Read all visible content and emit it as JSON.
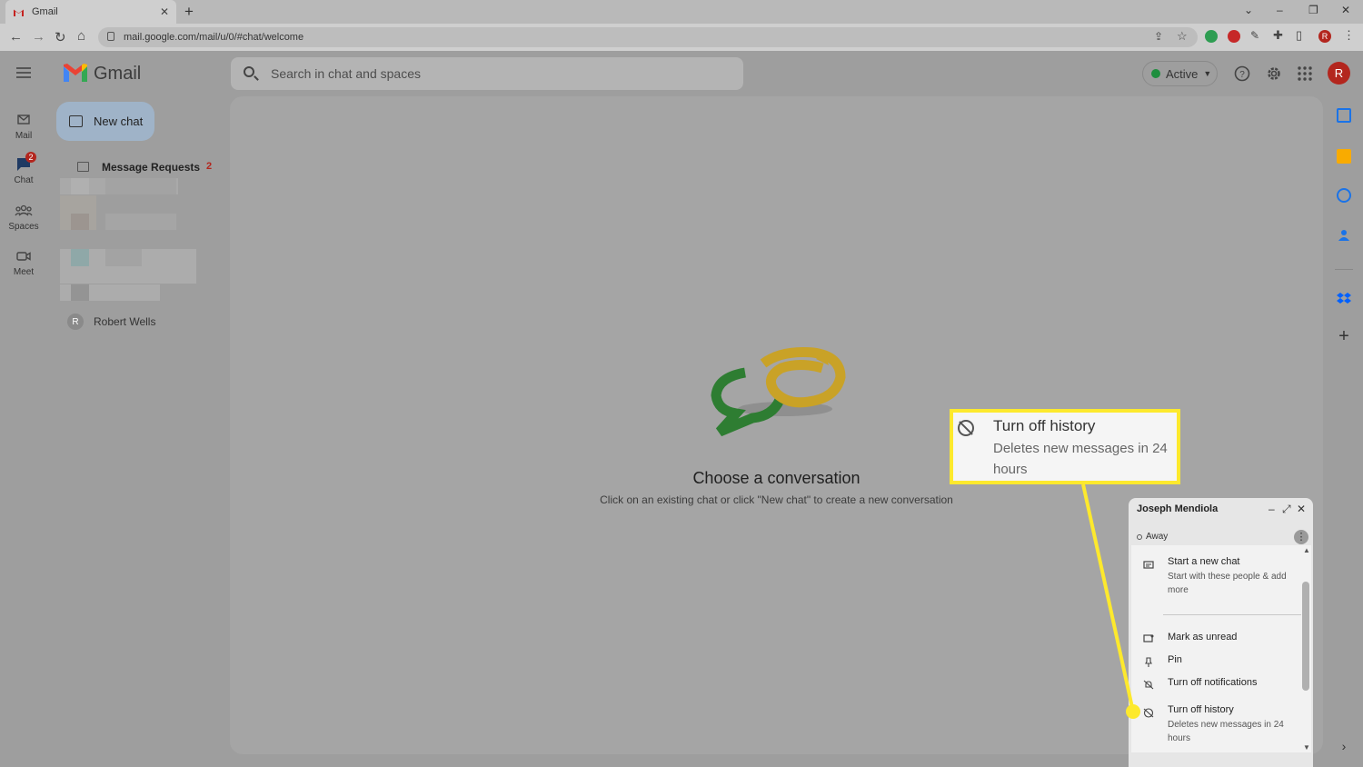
{
  "browser": {
    "tab_title": "Gmail",
    "tab_close": "✕",
    "new_tab": "+",
    "url": "mail.google.com/mail/u/0/#chat/welcome"
  },
  "header": {
    "app_name": "Gmail",
    "search_placeholder": "Search in chat and spaces",
    "status_label": "Active",
    "avatar_initial": "R"
  },
  "rail": {
    "items": [
      {
        "label": "Mail",
        "icon": "mail-icon"
      },
      {
        "label": "Chat",
        "icon": "chat-icon",
        "badge": "2"
      },
      {
        "label": "Spaces",
        "icon": "spaces-icon"
      },
      {
        "label": "Meet",
        "icon": "meet-icon"
      }
    ]
  },
  "sidepanel": {
    "new_chat_label": "New chat",
    "message_requests_label": "Message Requests",
    "message_requests_count": "2",
    "contact_name": "Robert Wells",
    "contact_initial": "R"
  },
  "main": {
    "title": "Choose a conversation",
    "subtitle": "Click on an existing chat or click \"New chat\" to create a new conversation"
  },
  "chat_window": {
    "contact": "Joseph Mendiola",
    "status": "Away",
    "menu": [
      {
        "label": "Start a new chat",
        "desc": "Start with these people & add more",
        "icon": "new-chat-icon"
      },
      {
        "label": "Mark as unread",
        "icon": "mark-unread-icon"
      },
      {
        "label": "Pin",
        "icon": "pin-icon"
      },
      {
        "label": "Turn off notifications",
        "icon": "notifications-off-icon"
      },
      {
        "label": "Turn off history",
        "desc": "Deletes new messages in 24 hours",
        "icon": "history-off-icon"
      }
    ]
  },
  "callout": {
    "title": "Turn off history",
    "desc": "Deletes new messages in 24 hours"
  },
  "colors": {
    "accent_red": "#b3261e",
    "active_green": "#1e8e3e",
    "highlight_yellow": "#fde92d"
  }
}
